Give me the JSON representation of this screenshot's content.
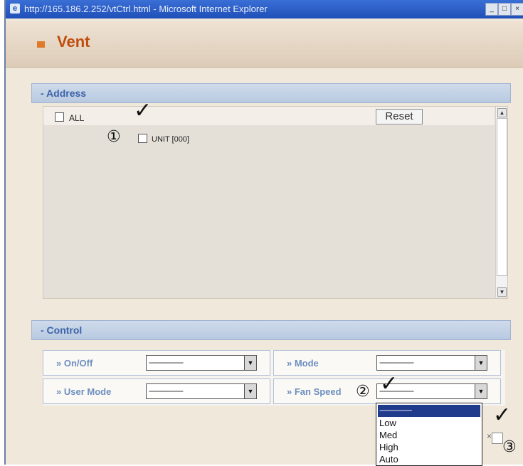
{
  "window": {
    "title": "http://165.186.2.252/vtCtrl.html - Microsoft Internet Explorer",
    "buttons": [
      "_",
      "□",
      "×"
    ]
  },
  "header": {
    "title": "Vent"
  },
  "address": {
    "section_label": "- Address",
    "all_label": "ALL",
    "unit_label": "UNIT [000]",
    "reset_label": "Reset"
  },
  "control": {
    "section_label": "- Control",
    "onoff_label": "» On/Off",
    "mode_label": "» Mode",
    "user_mode_label": "» User Mode",
    "fan_speed_label": "» Fan Speed",
    "select_value": "----------------",
    "fan_options": [
      "-----------------",
      "Low",
      "Med",
      "High",
      "Auto"
    ]
  },
  "annotations": {
    "marker1": "①",
    "marker2": "②",
    "marker3": "③",
    "check": "✓"
  }
}
